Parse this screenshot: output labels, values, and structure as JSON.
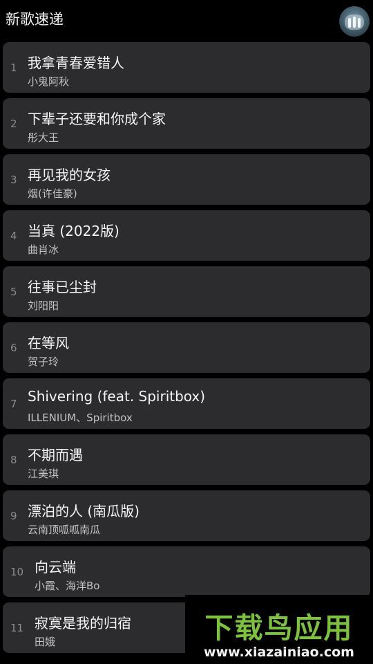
{
  "header": {
    "title": "新歌速递"
  },
  "songs": [
    {
      "num": "1",
      "title": "我拿青春爱错人",
      "artist": "小鬼阿秋"
    },
    {
      "num": "2",
      "title": "下辈子还要和你成个家",
      "artist": "彤大王"
    },
    {
      "num": "3",
      "title": "再见我的女孩",
      "artist": "烟(许佳豪)"
    },
    {
      "num": "4",
      "title": "当真 (2022版)",
      "artist": "曲肖冰"
    },
    {
      "num": "5",
      "title": "往事已尘封",
      "artist": "刘阳阳"
    },
    {
      "num": "6",
      "title": "在等风",
      "artist": "贺子玲"
    },
    {
      "num": "7",
      "title": "Shivering (feat. Spiritbox)",
      "artist": "ILLENIUM、Spiritbox"
    },
    {
      "num": "8",
      "title": "不期而遇",
      "artist": "江美琪"
    },
    {
      "num": "9",
      "title": "漂泊的人 (南瓜版)",
      "artist": "云南顶呱呱南瓜"
    },
    {
      "num": "10",
      "title": "向云端",
      "artist": "小霞、海洋Bo"
    },
    {
      "num": "11",
      "title": "寂寞是我的归宿",
      "artist": "田娥"
    }
  ],
  "watermark": {
    "brand": "下载鸟应用",
    "url": "www.xiazainiao.com"
  },
  "colors": {
    "background": "#000000",
    "card": "#2c2c2e",
    "watermark_green": "#7cc23a"
  },
  "icons": {
    "avatar": "music-avatar-icon"
  }
}
